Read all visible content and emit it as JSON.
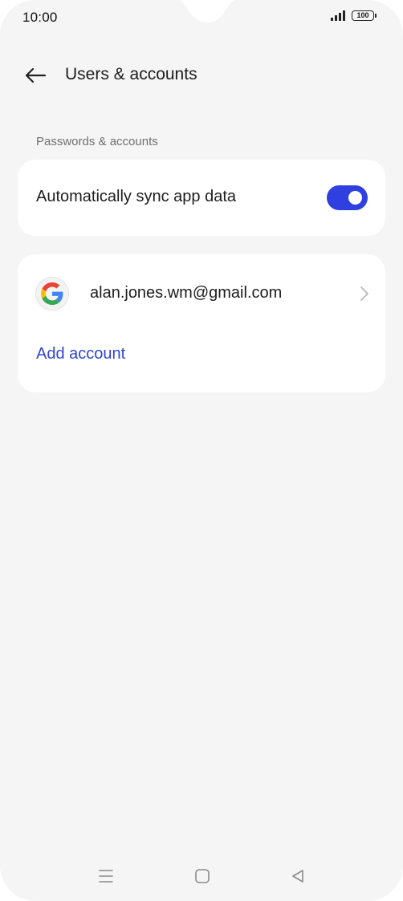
{
  "status_bar": {
    "time": "10:00",
    "battery_level": "100",
    "icons": [
      "signal-icon",
      "battery-icon"
    ]
  },
  "header": {
    "title": "Users & accounts",
    "back_icon": "arrow-left-icon"
  },
  "section": {
    "label": "Passwords & accounts"
  },
  "sync": {
    "label": "Automatically sync app data",
    "enabled": true,
    "accent_color": "#3040e0"
  },
  "accounts": {
    "items": [
      {
        "email": "alan.jones.wm@gmail.com",
        "icon": "google-icon"
      }
    ],
    "add_label": "Add account",
    "link_color": "#2f44d3"
  },
  "nav": {
    "buttons": [
      "menu-icon",
      "home-icon",
      "back-triangle-icon"
    ]
  }
}
